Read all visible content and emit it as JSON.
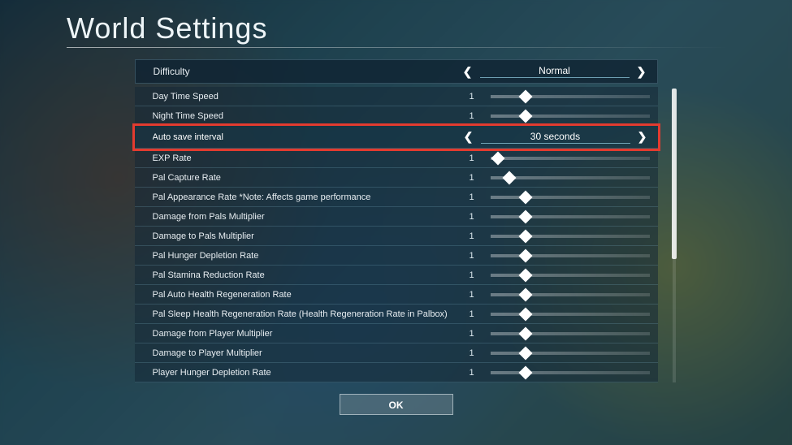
{
  "title": "World Settings",
  "ok_label": "OK",
  "difficulty": {
    "label": "Difficulty",
    "value": "Normal"
  },
  "autosave": {
    "label": "Auto save interval",
    "value": "30 seconds"
  },
  "settings": [
    {
      "label": "Day Time Speed",
      "value": "1",
      "pos": 22
    },
    {
      "label": "Night Time Speed",
      "value": "1",
      "pos": 22
    },
    {
      "label": "EXP Rate",
      "value": "1",
      "pos": 5
    },
    {
      "label": "Pal Capture Rate",
      "value": "1",
      "pos": 12
    },
    {
      "label": "Pal Appearance Rate *Note: Affects game performance",
      "value": "1",
      "pos": 22
    },
    {
      "label": "Damage from Pals Multiplier",
      "value": "1",
      "pos": 22
    },
    {
      "label": "Damage to Pals Multiplier",
      "value": "1",
      "pos": 22
    },
    {
      "label": "Pal Hunger Depletion Rate",
      "value": "1",
      "pos": 22
    },
    {
      "label": "Pal Stamina Reduction Rate",
      "value": "1",
      "pos": 22
    },
    {
      "label": "Pal Auto Health Regeneration Rate",
      "value": "1",
      "pos": 22
    },
    {
      "label": "Pal Sleep Health Regeneration Rate (Health Regeneration Rate in Palbox)",
      "value": "1",
      "pos": 22
    },
    {
      "label": "Damage from Player Multiplier",
      "value": "1",
      "pos": 22
    },
    {
      "label": "Damage to Player Multiplier",
      "value": "1",
      "pos": 22
    },
    {
      "label": "Player Hunger Depletion Rate",
      "value": "1",
      "pos": 22
    }
  ]
}
